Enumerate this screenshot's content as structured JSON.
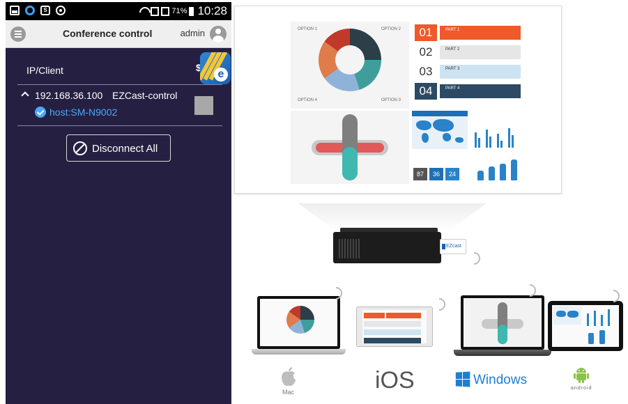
{
  "status_bar": {
    "battery_pct": "71%",
    "time": "10:28",
    "icons": [
      "gallery-icon",
      "circle-icon",
      "s-icon",
      "sync-icon",
      "wifi-icon",
      "signal-icon",
      "signal-icon",
      "battery-icon"
    ]
  },
  "header": {
    "title": "Conference control",
    "user": "admin"
  },
  "list": {
    "column_header": "IP/Client",
    "clients": [
      {
        "ip": "192.168.36.100",
        "name": "EZCast-control",
        "host": "host:SM-N9002",
        "expanded": true,
        "verified": true
      }
    ]
  },
  "actions": {
    "disconnect_all": "Disconnect All"
  },
  "promo": {
    "steps": [
      "01",
      "02",
      "03",
      "04"
    ],
    "stats": [
      "87",
      "36",
      "24"
    ],
    "os_labels": {
      "ios": "iOS",
      "mac": "Mac",
      "windows": "Windows",
      "android": "android"
    }
  },
  "colors": {
    "app_background": "#252042",
    "title_bar": "#efefef",
    "accent_blue": "#4aa8ff",
    "windows_blue": "#1d7fd0"
  }
}
